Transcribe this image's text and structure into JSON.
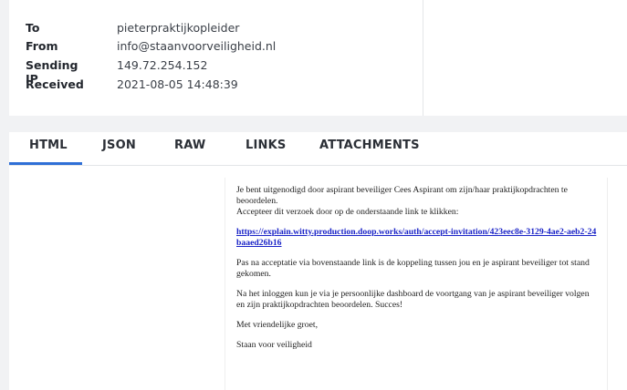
{
  "meta": [
    {
      "label": "To",
      "value": "pieterpraktijkopleider"
    },
    {
      "label": "From",
      "value": "info@staanvoorveiligheid.nl"
    },
    {
      "label": "Sending IP",
      "value": "149.72.254.152"
    },
    {
      "label": "Received",
      "value": "2021-08-05 14:48:39"
    }
  ],
  "tabs": [
    {
      "label": "HTML"
    },
    {
      "label": "JSON"
    },
    {
      "label": "RAW"
    },
    {
      "label": "LINKS"
    },
    {
      "label": "ATTACHMENTS"
    }
  ],
  "active_tab": "HTML",
  "email": {
    "intro": "Je bent uitgenodigd door aspirant beveiliger Cees Aspirant om zijn/haar praktijkopdrachten te beoordelen.",
    "instruction": "Accepteer dit verzoek door op de onderstaande link te klikken:",
    "link": "https://explain.witty.production.doop.works/auth/accept-invitation/423eec8e-3129-4ae2-aeb2-24baaed26b16",
    "paragraph2": "Pas na acceptatie via bovenstaande link is de koppeling tussen jou en je aspirant beveiliger tot stand gekomen.",
    "paragraph3": "Na het inloggen kun je via je persoonlijke dashboard de voortgang van je aspirant beveiliger volgen en zijn praktijkopdrachten beoordelen. Succes!",
    "closing": "Met vriendelijke groet,",
    "signature": "Staan voor veiligheid"
  },
  "colors": {
    "accent": "#2f6fd6",
    "link": "#1a23c7"
  }
}
